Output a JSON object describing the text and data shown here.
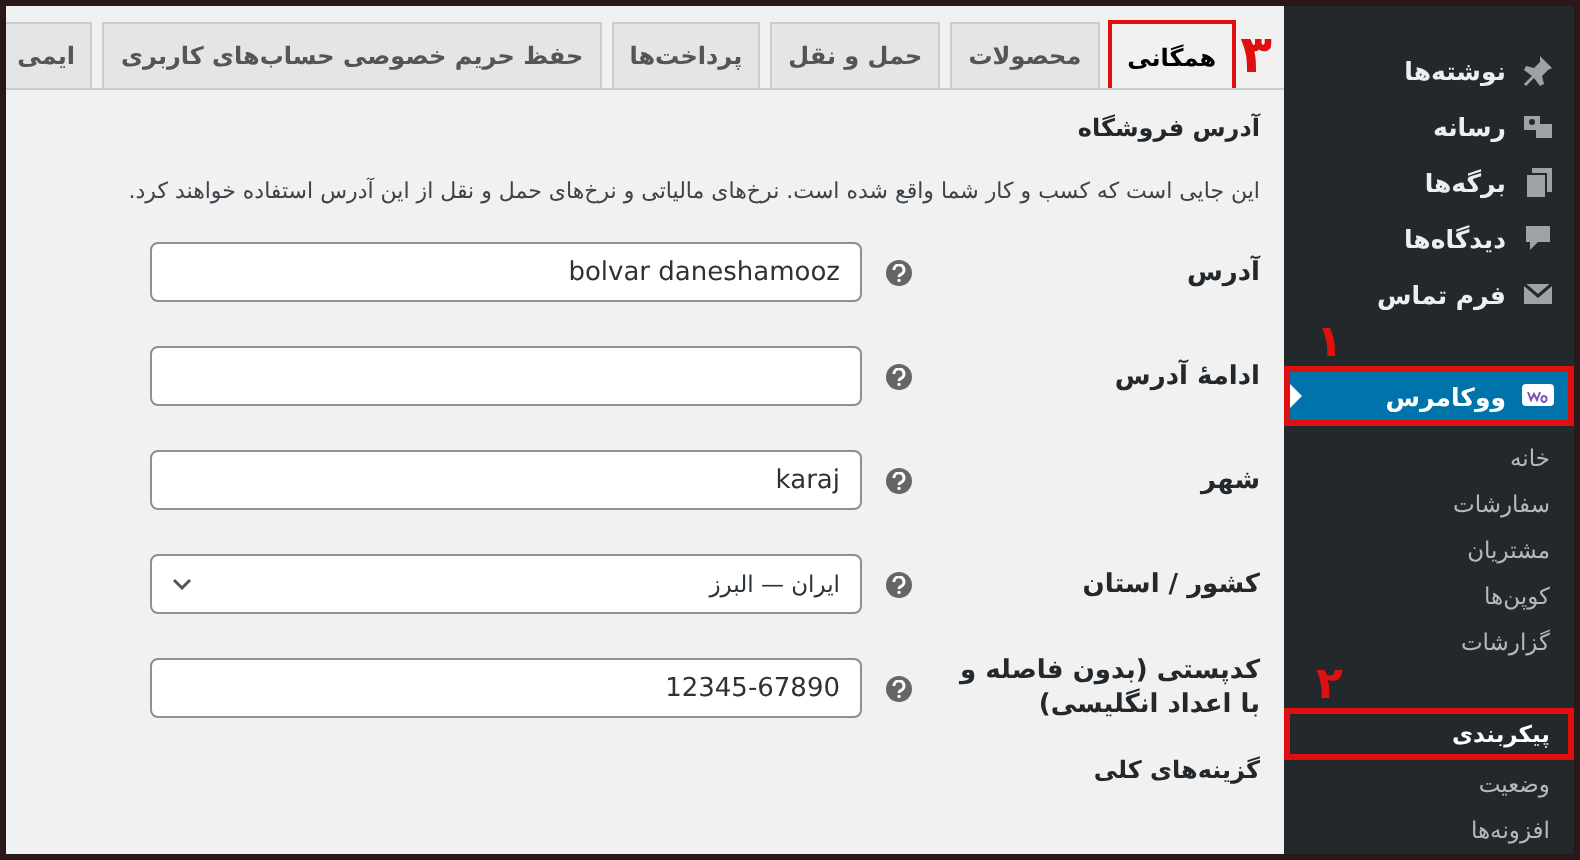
{
  "tabs": [
    {
      "label": "همگانی",
      "selected": true,
      "annotation": "۳"
    },
    {
      "label": "محصولات",
      "selected": false
    },
    {
      "label": "حمل و نقل",
      "selected": false
    },
    {
      "label": "پرداخت‌ها",
      "selected": false
    },
    {
      "label": "حفظ حریم خصوصی حساب‌های کاربری",
      "selected": false
    },
    {
      "label": "ایمی",
      "selected": false
    }
  ],
  "section": {
    "title": "آدرس فروشگاه",
    "description": "این جایی است که کسب و کار شما واقع شده است. نرخ‌های مالیاتی و نرخ‌های حمل و نقل از این آدرس استفاده خواهند کرد."
  },
  "fields": [
    {
      "kind": "text",
      "label": "آدرس",
      "value": "bolvar daneshamooz"
    },
    {
      "kind": "text",
      "label": "ادامهٔ آدرس"
    },
    {
      "kind": "text",
      "label": "شهر",
      "value": "karaj"
    },
    {
      "kind": "select",
      "label": "کشور / استان",
      "value": "ایران — البرز"
    },
    {
      "kind": "text",
      "label": "کدپستی (بدون فاصله و با اعداد انگلیسی)",
      "value": "12345-67890"
    }
  ],
  "next_section": {
    "title": "گزینه‌های کلی"
  },
  "sidebar": {
    "items": [
      {
        "label": "نوشته‌ها",
        "selected": false
      },
      {
        "label": "رسانه",
        "selected": false
      },
      {
        "label": "برگه‌ها",
        "selected": false
      },
      {
        "label": "دیدگاه‌ها",
        "selected": false
      },
      {
        "label": "فرم تماس",
        "selected": false
      },
      {
        "label": "ووکامرس",
        "selected": true,
        "annotation": "۱",
        "children": [
          {
            "label": "خانه",
            "selected": false
          },
          {
            "label": "سفارشات",
            "selected": false
          },
          {
            "label": "مشتریان",
            "selected": false
          },
          {
            "label": "کوپن‌ها",
            "selected": false
          },
          {
            "label": "گزارشات",
            "selected": false
          },
          {
            "label": "پیکربندی",
            "selected": true,
            "annotation": "۲"
          },
          {
            "label": "وضعیت",
            "selected": false
          },
          {
            "label": "افزونه‌ها",
            "selected": false
          }
        ]
      }
    ]
  }
}
